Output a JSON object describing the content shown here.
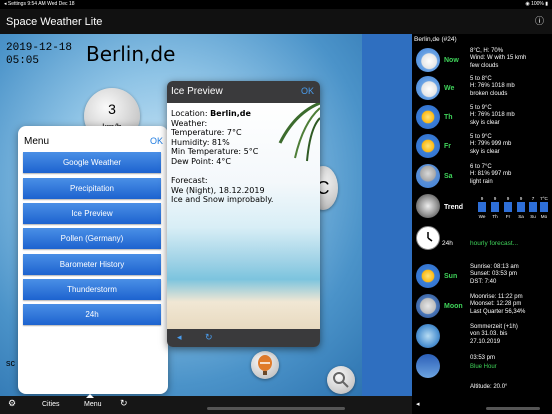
{
  "status": {
    "left": "◂ Settings  9:54 AM  Wed Dec 18",
    "right": "◉ 100% ▮"
  },
  "app": {
    "title": "Space Weather Lite",
    "info": "ⓘ"
  },
  "main": {
    "date": "2019-12-18",
    "time": "05:05",
    "city": "Berlin,de",
    "wind_value": "3",
    "wind_unit": "km/h",
    "temp_partial": "C",
    "sc_text": "sc"
  },
  "menu": {
    "title": "Menu",
    "ok": "OK",
    "items": [
      "Google Weather",
      "Precipitation",
      "Ice Preview",
      "Pollen (Germany)",
      "Barometer History",
      "Thunderstorm",
      "24h"
    ]
  },
  "ice": {
    "title": "Ice Preview",
    "ok": "OK",
    "location_label": "Location: ",
    "location": "Berlin,de",
    "lines": "Weather:\nTemperature: 7°C\nHumidity: 81%\nMin Temperature: 5°C\nDew Point: 4°C\n\nForecast:\nWe (Night), 18.12.2019\nIce and Snow improbably.",
    "back": "◂",
    "reload": "↻"
  },
  "panel": {
    "title": "Berlin,de (#24)",
    "rows": [
      {
        "day": "Now",
        "text": "8°C, H: 70%\nWind: W with 15 kmh\nfew clouds",
        "icon": "cloud-icon"
      },
      {
        "day": "We",
        "text": "5 to 8°C\nH: 76% 1018 mb\nbroken clouds",
        "icon": "cloud-icon"
      },
      {
        "day": "Th",
        "text": "5 to 9°C\nH: 76% 1018 mb\nsky is clear",
        "icon": "sun-icon"
      },
      {
        "day": "Fr",
        "text": "5 to 9°C\nH: 79% 999 mb\nsky is clear",
        "icon": "sun-icon"
      },
      {
        "day": "Sa",
        "text": "6 to 7°C\nH: 81% 997 mb\nlight rain",
        "icon": "rain-icon"
      }
    ],
    "trend": {
      "label": "Trend",
      "days": [
        "We",
        "Th",
        "Fr",
        "Sa",
        "Su",
        "Mo"
      ],
      "tops": [
        "9",
        "9",
        "9",
        "9",
        "7",
        "7°C"
      ]
    },
    "h24": "24h",
    "hourly": "hourly forecast...",
    "sun": {
      "day": "Sun",
      "text": "Sunrise: 08:13 am\nSunset: 03:53 pm\nDST: 7:40"
    },
    "moon": {
      "day": "Moon",
      "text": "Moonrise: 11:22 pm\nMoonset: 12:28 pm\nLast Quarter 56,34%"
    },
    "summer": {
      "text": "Sommerzeit (+1h)\nvon 31.03. bis\n27.10.2019"
    },
    "blue": {
      "time": "03:53 pm",
      "label": "Blue Hour"
    },
    "altitude": "Altitude: 20.0°"
  },
  "tabs": {
    "cities": "Cities",
    "menu": "Menu",
    "refresh": "↻",
    "icon": "⚙"
  }
}
